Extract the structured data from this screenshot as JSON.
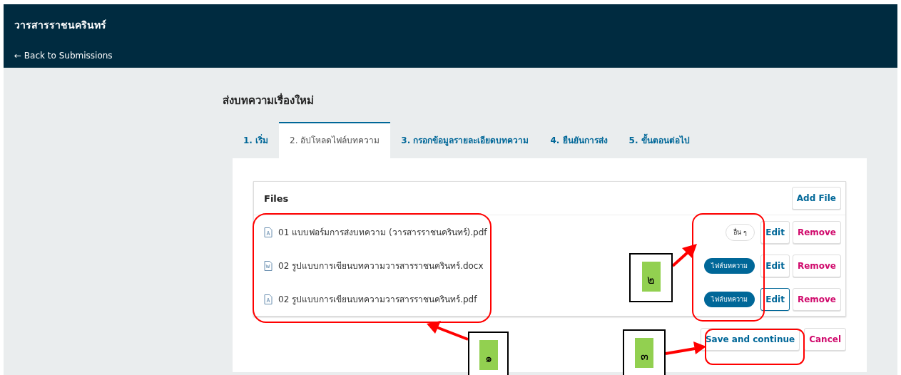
{
  "header": {
    "title": "วารสารราชนครินทร์",
    "back_link": "← Back to Submissions"
  },
  "page_title": "ส่งบทความเรื่องใหม่",
  "tabs": [
    {
      "label": "1. เริ่ม",
      "selected": false
    },
    {
      "label": "2. อัปโหลดไฟล์บทความ",
      "selected": true
    },
    {
      "label": "3. กรอกข้อมูลรายละเอียดบทความ",
      "selected": false
    },
    {
      "label": "4. ยืนยันการส่ง",
      "selected": false
    },
    {
      "label": "5. ขั้นตอนต่อไป",
      "selected": false
    }
  ],
  "files_panel": {
    "heading": "Files",
    "add_button": "Add File",
    "files": [
      {
        "kind": "pdf",
        "name": "01 แบบฟอร์มการส่งบทความ (วารสารราชนครินทร์).pdf",
        "genre": "อื่น ๆ",
        "genre_filled": false,
        "edit": "Edit",
        "edit_focused": false,
        "remove": "Remove"
      },
      {
        "kind": "docx",
        "name": "02 รูปแบบการเขียนบทความวารสารราชนครินทร์.docx",
        "genre": "ไฟล์บทความ",
        "genre_filled": true,
        "edit": "Edit",
        "edit_focused": false,
        "remove": "Remove"
      },
      {
        "kind": "pdf",
        "name": "02 รูปแบบการเขียนบทความวารสารราชนครินทร์.pdf",
        "genre": "ไฟล์บทความ",
        "genre_filled": true,
        "edit": "Edit",
        "edit_focused": true,
        "remove": "Remove"
      }
    ]
  },
  "actions": {
    "save": "Save and continue",
    "cancel": "Cancel"
  },
  "annotations": [
    {
      "label": "๑"
    },
    {
      "label": "๒"
    },
    {
      "label": "๓"
    }
  ]
}
